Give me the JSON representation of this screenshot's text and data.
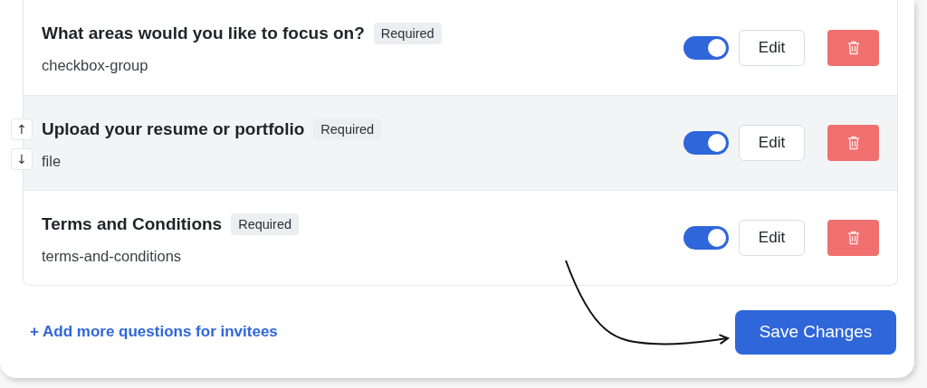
{
  "questions": [
    {
      "title": "What areas would you like to focus on?",
      "badge": "Required",
      "type": "checkbox-group",
      "on": true,
      "hovered": false,
      "edit": "Edit"
    },
    {
      "title": "Upload your resume or portfolio",
      "badge": "Required",
      "type": "file",
      "on": true,
      "hovered": true,
      "move_up": "↑",
      "move_down": "↓",
      "edit": "Edit"
    },
    {
      "title": "Terms and Conditions",
      "badge": "Required",
      "type": "terms-and-conditions",
      "on": true,
      "hovered": false,
      "edit": "Edit"
    }
  ],
  "add_link": "+ Add more questions for invitees",
  "save_button": "Save Changes"
}
